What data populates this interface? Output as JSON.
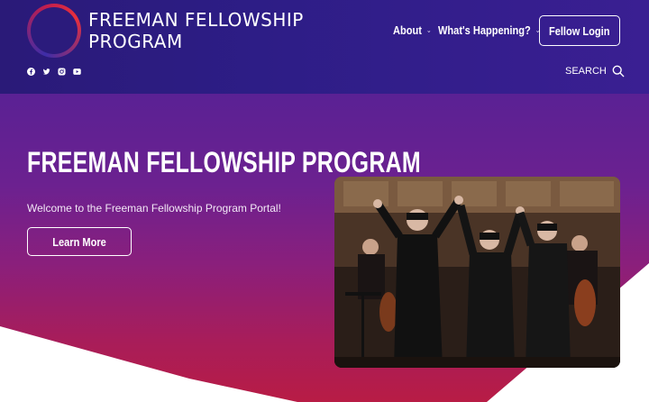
{
  "header": {
    "logo_line1": "FREEMAN FELLOWSHIP",
    "logo_line2": "PROGRAM",
    "nav": [
      {
        "label": "About"
      },
      {
        "label": "What's Happening?"
      }
    ],
    "login_label": "Fellow Login",
    "search_label": "SEARCH",
    "social_icons": [
      "facebook-icon",
      "twitter-icon",
      "instagram-icon",
      "youtube-icon"
    ]
  },
  "hero": {
    "title": "FREEMAN FELLOWSHIP PROGRAM",
    "subtitle": "Welcome to the Freeman Fellowship Program Portal!",
    "cta_label": "Learn More"
  },
  "colors": {
    "header_bg": "#2d1d86",
    "hero_top": "#5a2194",
    "hero_bottom": "#b81c45",
    "logo_ring_red": "#e8303c"
  }
}
